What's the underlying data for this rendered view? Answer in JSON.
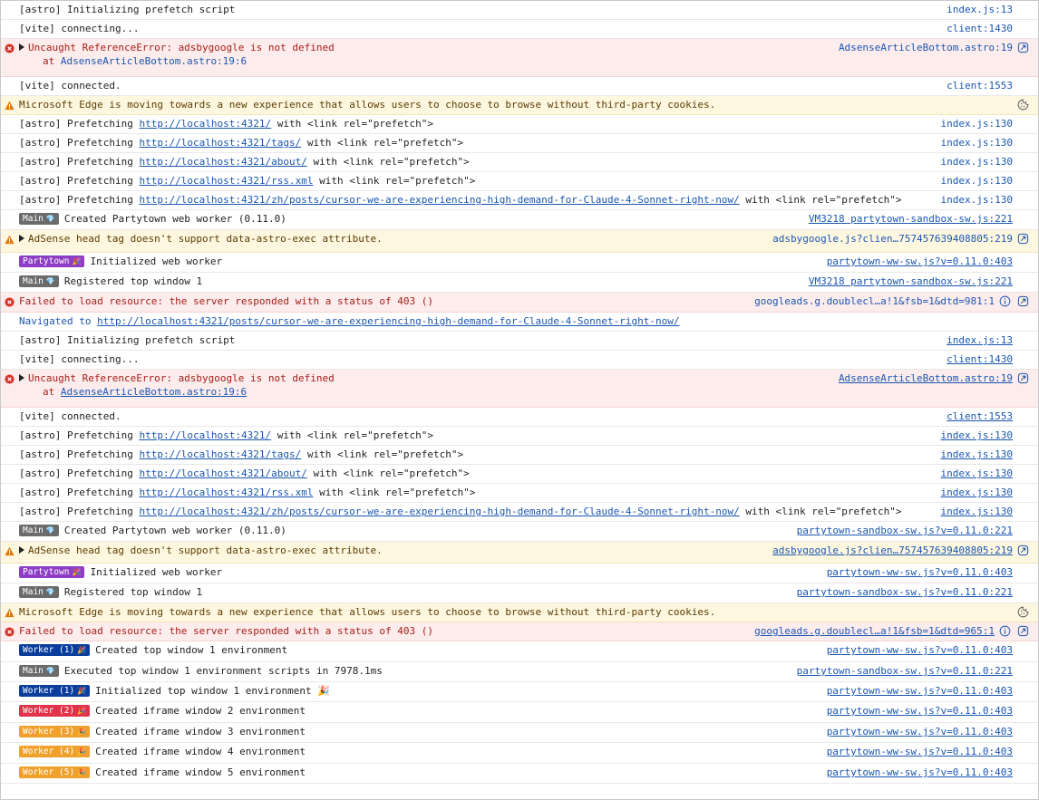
{
  "colors": {
    "error_bg": "#fdecec",
    "warning_bg": "#fef7e0",
    "link": "#1a56b0",
    "badge_main": "#6b6b6b",
    "badge_partytown": "#8e3ec5",
    "badge_worker1": "#0a3d9c",
    "badge_worker2": "#e0334a",
    "badge_worker3": "#f0a12c"
  },
  "rows": [
    {
      "type": "log",
      "text": "[astro] Initializing prefetch script",
      "source": "index.js:13"
    },
    {
      "type": "log",
      "text": "[vite] connecting...",
      "source": "client:1430"
    },
    {
      "type": "error",
      "expandable": true,
      "text": "Uncaught ReferenceError: adsbygoogle is not defined",
      "stack_prefix": "at ",
      "stack_link": "AdsenseArticleBottom.astro:19:6",
      "source": "AdsenseArticleBottom.astro:19",
      "icon": "ai-explain-icon"
    },
    {
      "type": "log",
      "text": "[vite] connected.",
      "source": "client:1553"
    },
    {
      "type": "warning",
      "text": "Microsoft Edge is moving towards a new experience that allows users to choose to browse without third-party cookies.",
      "icon": "cookie-icon"
    },
    {
      "type": "log",
      "prefix": "[astro] Prefetching ",
      "link": "http://localhost:4321/",
      "suffix": " with <link rel=\"prefetch\">",
      "source": "index.js:130"
    },
    {
      "type": "log",
      "prefix": "[astro] Prefetching ",
      "link": "http://localhost:4321/tags/",
      "suffix": " with <link rel=\"prefetch\">",
      "source": "index.js:130"
    },
    {
      "type": "log",
      "prefix": "[astro] Prefetching ",
      "link": "http://localhost:4321/about/",
      "suffix": " with <link rel=\"prefetch\">",
      "source": "index.js:130"
    },
    {
      "type": "log",
      "prefix": "[astro] Prefetching ",
      "link": "http://localhost:4321/rss.xml",
      "suffix": " with <link rel=\"prefetch\">",
      "source": "index.js:130"
    },
    {
      "type": "log",
      "prefix": "[astro] Prefetching ",
      "link": "http://localhost:4321/zh/posts/cursor-we-are-experiencing-high-demand-for-Claude-4-Sonnet-right-now/",
      "suffix": " with <link rel=\"prefetch\">",
      "source": "index.js:130"
    },
    {
      "type": "log",
      "badge": "Main",
      "badge_emoji": "💎",
      "text": "Created Partytown web worker (0.11.0)",
      "source": "VM3218 partytown-sandbox-sw.js:221",
      "source_u": true
    },
    {
      "type": "warning",
      "expandable": true,
      "text": "AdSense head tag doesn't support data-astro-exec attribute.",
      "source": "adsbygoogle.js?clien…757457639408805:219",
      "icon": "ai-explain-icon"
    },
    {
      "type": "log",
      "badge": "Partytown",
      "badge_emoji": "🎉",
      "text": "Initialized web worker",
      "source": "partytown-ww-sw.js?v=0.11.0:403",
      "source_u": true
    },
    {
      "type": "log",
      "badge": "Main",
      "badge_emoji": "💎",
      "text": "Registered top window 1",
      "source": "VM3218 partytown-sandbox-sw.js:221",
      "source_u": true
    },
    {
      "type": "error",
      "text": "Failed to load resource: the server responded with a status of 403 ()",
      "source": "googleads.g.doublecl…a!1&fsb=1&dtd=981:1",
      "icon": "ai-explain-icon",
      "icon2": "info-icon"
    },
    {
      "type": "nav",
      "prefix": "Navigated to ",
      "link": "http://localhost:4321/posts/cursor-we-are-experiencing-high-demand-for-Claude-4-Sonnet-right-now/"
    },
    {
      "type": "log",
      "text": "[astro] Initializing prefetch script",
      "source": "index.js:13",
      "source_u": true
    },
    {
      "type": "log",
      "text": "[vite] connecting...",
      "source": "client:1430",
      "source_u": true
    },
    {
      "type": "error",
      "expandable": true,
      "text": "Uncaught ReferenceError: adsbygoogle is not defined",
      "stack_prefix": "at ",
      "stack_link": "AdsenseArticleBottom.astro:19:6",
      "source": "AdsenseArticleBottom.astro:19",
      "source_u": true,
      "icon": "ai-explain-icon"
    },
    {
      "type": "log",
      "text": "[vite] connected.",
      "source": "client:1553",
      "source_u": true
    },
    {
      "type": "log",
      "prefix": "[astro] Prefetching ",
      "link": "http://localhost:4321/",
      "suffix": " with <link rel=\"prefetch\">",
      "source": "index.js:130",
      "source_u": true
    },
    {
      "type": "log",
      "prefix": "[astro] Prefetching ",
      "link": "http://localhost:4321/tags/",
      "suffix": " with <link rel=\"prefetch\">",
      "source": "index.js:130",
      "source_u": true
    },
    {
      "type": "log",
      "prefix": "[astro] Prefetching ",
      "link": "http://localhost:4321/about/",
      "suffix": " with <link rel=\"prefetch\">",
      "source": "index.js:130",
      "source_u": true
    },
    {
      "type": "log",
      "prefix": "[astro] Prefetching ",
      "link": "http://localhost:4321/rss.xml",
      "suffix": " with <link rel=\"prefetch\">",
      "source": "index.js:130",
      "source_u": true
    },
    {
      "type": "log",
      "prefix": "[astro] Prefetching ",
      "link": "http://localhost:4321/zh/posts/cursor-we-are-experiencing-high-demand-for-Claude-4-Sonnet-right-now/",
      "suffix": " with <link rel=\"prefetch\">",
      "source": "index.js:130",
      "source_u": true
    },
    {
      "type": "log",
      "badge": "Main",
      "badge_emoji": "💎",
      "text": "Created Partytown web worker (0.11.0)",
      "source": "partytown-sandbox-sw.js?v=0.11.0:221",
      "source_u": true
    },
    {
      "type": "warning",
      "expandable": true,
      "text": "AdSense head tag doesn't support data-astro-exec attribute.",
      "source": "adsbygoogle.js?clien…757457639408805:219",
      "source_u": true,
      "icon": "ai-explain-icon"
    },
    {
      "type": "log",
      "badge": "Partytown",
      "badge_emoji": "🎉",
      "text": "Initialized web worker",
      "source": "partytown-ww-sw.js?v=0.11.0:403",
      "source_u": true
    },
    {
      "type": "log",
      "badge": "Main",
      "badge_emoji": "💎",
      "text": "Registered top window 1",
      "source": "partytown-sandbox-sw.js?v=0.11.0:221",
      "source_u": true
    },
    {
      "type": "warning",
      "text": "Microsoft Edge is moving towards a new experience that allows users to choose to browse without third-party cookies.",
      "icon": "cookie-icon"
    },
    {
      "type": "error",
      "text": "Failed to load resource: the server responded with a status of 403 ()",
      "source": "googleads.g.doublecl…a!1&fsb=1&dtd=965:1",
      "source_u": true,
      "icon": "ai-explain-icon",
      "icon2": "info-icon"
    },
    {
      "type": "log",
      "badge": "Worker (1)",
      "badge_emoji": "🎉",
      "badge_color": "badge_worker1",
      "text": "Created top window 1 environment",
      "source": "partytown-ww-sw.js?v=0.11.0:403",
      "source_u": true
    },
    {
      "type": "log",
      "badge": "Main",
      "badge_emoji": "💎",
      "text": "Executed top window 1 environment scripts in 7978.1ms",
      "source": "partytown-sandbox-sw.js?v=0.11.0:221",
      "source_u": true
    },
    {
      "type": "log",
      "badge": "Worker (1)",
      "badge_emoji": "🎉",
      "badge_color": "badge_worker1",
      "text": "Initialized top window 1 environment 🎉",
      "source": "partytown-ww-sw.js?v=0.11.0:403",
      "source_u": true
    },
    {
      "type": "log",
      "badge": "Worker (2)",
      "badge_emoji": "🎉",
      "badge_color": "badge_worker2",
      "text": "Created iframe window 2 environment",
      "source": "partytown-ww-sw.js?v=0.11.0:403",
      "source_u": true
    },
    {
      "type": "log",
      "badge": "Worker (3)",
      "badge_emoji": "🎉",
      "badge_color": "badge_worker3",
      "text": "Created iframe window 3 environment",
      "source": "partytown-ww-sw.js?v=0.11.0:403",
      "source_u": true
    },
    {
      "type": "log",
      "badge": "Worker (4)",
      "badge_emoji": "🎉",
      "badge_color": "badge_worker3",
      "text": "Created iframe window 4 environment",
      "source": "partytown-ww-sw.js?v=0.11.0:403",
      "source_u": true
    },
    {
      "type": "log",
      "badge": "Worker (5)",
      "badge_emoji": "🎉",
      "badge_color": "badge_worker3",
      "text": "Created iframe window 5 environment",
      "source": "partytown-ww-sw.js?v=0.11.0:403",
      "source_u": true
    }
  ]
}
